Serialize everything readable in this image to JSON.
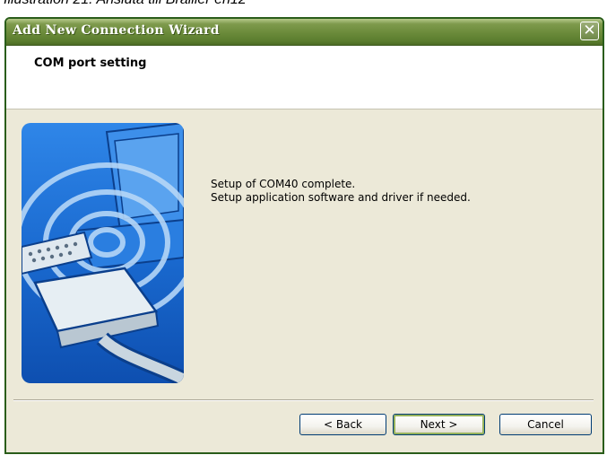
{
  "caption": "Illustration 21: Ansluta till Brailler en12",
  "window": {
    "title": "Add New Connection Wizard",
    "close_glyph": "✕"
  },
  "header": {
    "title": "COM port setting"
  },
  "content": {
    "line1": "Setup of COM40 complete.",
    "line2": " Setup application software and driver if needed.",
    "illustration": "serial-connector-waves-illustration"
  },
  "buttons": {
    "back": "< Back",
    "next": "Next >",
    "cancel": "Cancel"
  },
  "colors": {
    "titlebar": "#6a8a3a",
    "dialog_bg": "#ece9d8",
    "art_blue": "#1c6fd4"
  }
}
